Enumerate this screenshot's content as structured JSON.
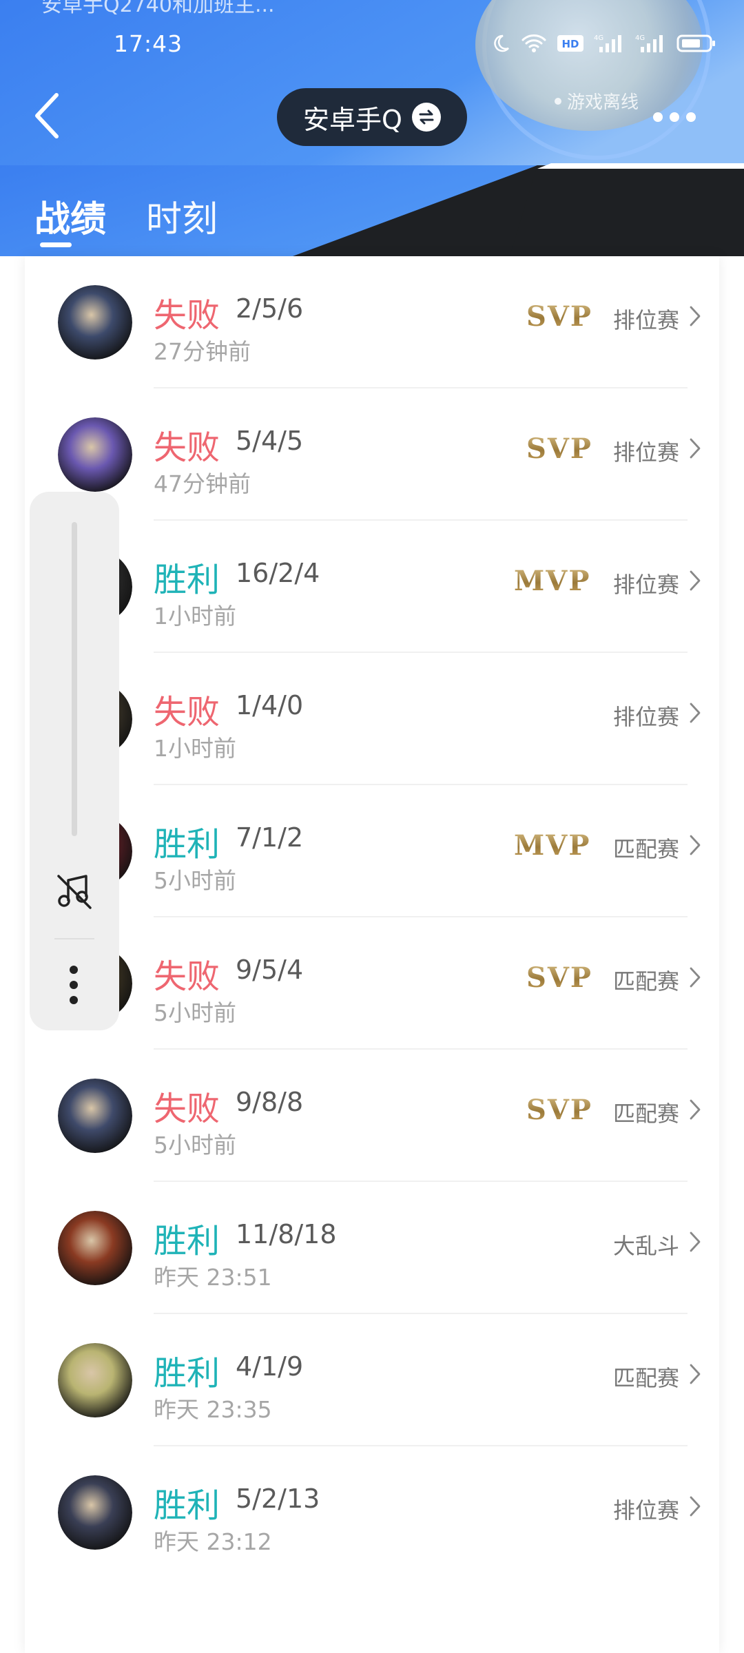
{
  "status_bar": {
    "time": "17:43",
    "top_text": "安卓手Q2740和加班主..."
  },
  "header": {
    "account_name": "安卓手Q",
    "online_status": "游戏离线"
  },
  "tabs": [
    {
      "label": "战绩",
      "active": true
    },
    {
      "label": "时刻",
      "active": false
    }
  ],
  "matches": [
    {
      "result": "失败",
      "outcome": "lose",
      "kda": "2/5/6",
      "time": "27分钟前",
      "badge": "SVP",
      "mode": "排位赛",
      "avatar_color": "#3d4a6b"
    },
    {
      "result": "失败",
      "outcome": "lose",
      "kda": "5/4/5",
      "time": "47分钟前",
      "badge": "SVP",
      "mode": "排位赛",
      "avatar_color": "#6a58b0"
    },
    {
      "result": "胜利",
      "outcome": "win",
      "kda": "16/2/4",
      "time": "1小时前",
      "badge": "MVP",
      "mode": "排位赛",
      "avatar_color": "#2b2b2b"
    },
    {
      "result": "失败",
      "outcome": "lose",
      "kda": "1/4/0",
      "time": "1小时前",
      "badge": "",
      "mode": "排位赛",
      "avatar_color": "#3a3428"
    },
    {
      "result": "胜利",
      "outcome": "win",
      "kda": "7/1/2",
      "time": "5小时前",
      "badge": "MVP",
      "mode": "匹配赛",
      "avatar_color": "#5a1e25"
    },
    {
      "result": "失败",
      "outcome": "lose",
      "kda": "9/5/4",
      "time": "5小时前",
      "badge": "SVP",
      "mode": "匹配赛",
      "avatar_color": "#3b3322"
    },
    {
      "result": "失败",
      "outcome": "lose",
      "kda": "9/8/8",
      "time": "5小时前",
      "badge": "SVP",
      "mode": "匹配赛",
      "avatar_color": "#3f4a6a"
    },
    {
      "result": "胜利",
      "outcome": "win",
      "kda": "11/8/18",
      "time": "昨天 23:51",
      "badge": "",
      "mode": "大乱斗",
      "avatar_color": "#8a3a22"
    },
    {
      "result": "胜利",
      "outcome": "win",
      "kda": "4/1/9",
      "time": "昨天 23:35",
      "badge": "",
      "mode": "匹配赛",
      "avatar_color": "#b9b472"
    },
    {
      "result": "胜利",
      "outcome": "win",
      "kda": "5/2/13",
      "time": "昨天 23:12",
      "badge": "",
      "mode": "排位赛",
      "avatar_color": "#3a3f55"
    }
  ],
  "colors": {
    "lose": "#ee6670",
    "win": "#1fb3b7",
    "header_blue": "#3f86f2"
  },
  "floating_panel": {
    "icons": [
      "music-off-icon",
      "more-vertical-icon"
    ]
  }
}
